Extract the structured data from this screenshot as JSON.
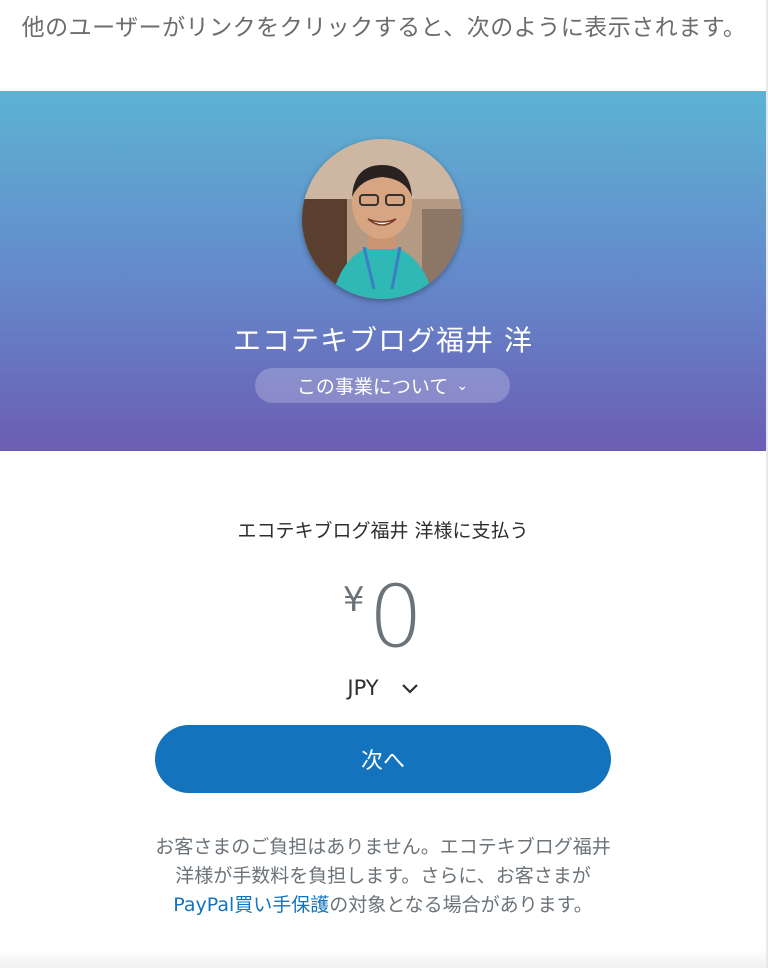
{
  "intro_text": "他のユーザーがリンクをクリックすると、次のように表示されます。",
  "merchant": {
    "name": "エコテキブログ福井 洋",
    "about_label": "この事業について"
  },
  "payment": {
    "pay_to": "エコテキブログ福井 洋様に支払う",
    "currency_symbol": "¥",
    "amount": "0",
    "currency_code": "JPY",
    "next_label": "次へ"
  },
  "fee_note": {
    "before": "お客さまのご負担はありません。エコテキブログ福井 洋様が手数料を負担します。さらに、お客さまが",
    "link": "PayPal買い手保護",
    "after": "の対象となる場合があります。"
  },
  "colors": {
    "gradient_top": "#5cb3d3",
    "gradient_bottom": "#6b5db4",
    "button": "#1473bd",
    "link": "#1473bd"
  }
}
